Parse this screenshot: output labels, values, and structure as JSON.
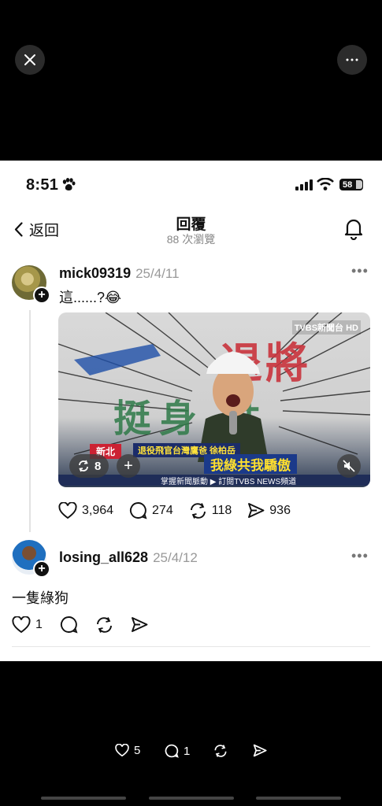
{
  "status": {
    "time": "8:51",
    "battery": "58"
  },
  "nav": {
    "back_label": "返回",
    "title": "回覆",
    "subtitle": "88 次瀏覽"
  },
  "post1": {
    "username": "mick09319",
    "date": "25/4/11",
    "text": "這......?😂",
    "video": {
      "logo": "TVBS新聞台 HD",
      "location": "新北",
      "caption_name": "退役飛官台灣鷹爸 徐柏岳",
      "headline": "我綠共我驕傲",
      "ticker": "掌握新聞脈動 ▶ 訂閱TVBS NEWS頻道",
      "repost_count": "8"
    },
    "likes": "3,964",
    "comments": "274",
    "reposts": "118",
    "shares": "936"
  },
  "post2": {
    "username": "losing_all628",
    "date": "25/4/12",
    "text": "一隻綠狗",
    "likes": "1"
  },
  "bottom": {
    "likes": "5",
    "comments": "1"
  },
  "icons": {
    "close": "close-icon",
    "more": "more-icon",
    "back": "chevron-left-icon",
    "bell": "bell-icon",
    "heart": "heart-icon",
    "comment": "comment-icon",
    "repost": "repost-icon",
    "share": "send-icon"
  }
}
